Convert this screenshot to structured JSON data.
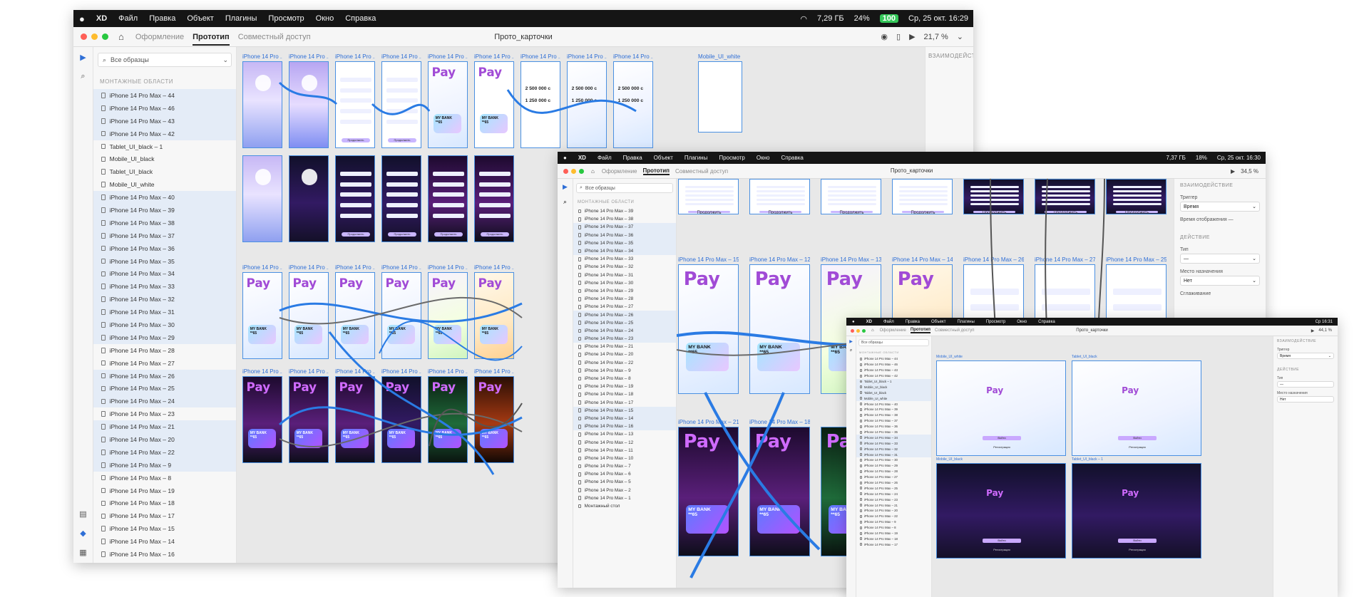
{
  "macos": {
    "app": "XD",
    "menu": [
      "Файл",
      "Правка",
      "Объект",
      "Плагины",
      "Просмотр",
      "Окно",
      "Справка"
    ],
    "status_memory": "7,29 ГБ",
    "status_battery": "24%",
    "status_badge": "100",
    "status_clock": "Ср, 25 окт.  16:29"
  },
  "toolbar": {
    "tabs": [
      "Оформление",
      "Прототип",
      "Совместный доступ"
    ],
    "active_tab": "Прототип",
    "doc_title": "Прото_карточки",
    "zoom": "21,7 %"
  },
  "sidebar": {
    "search_placeholder": "Все образцы",
    "section_title": "МОНТАЖНЫЕ ОБЛАСТИ",
    "items": [
      "iPhone 14 Pro Max – 44",
      "iPhone 14 Pro Max – 46",
      "iPhone 14 Pro Max – 43",
      "iPhone 14 Pro Max – 42",
      "Tablet_UI_black – 1",
      "Mobile_UI_black",
      "Tablet_UI_black",
      "Mobile_UI_white",
      "iPhone 14 Pro Max – 40",
      "iPhone 14 Pro Max – 39",
      "iPhone 14 Pro Max – 38",
      "iPhone 14 Pro Max – 37",
      "iPhone 14 Pro Max – 36",
      "iPhone 14 Pro Max – 35",
      "iPhone 14 Pro Max – 34",
      "iPhone 14 Pro Max – 33",
      "iPhone 14 Pro Max – 32",
      "iPhone 14 Pro Max – 31",
      "iPhone 14 Pro Max – 30",
      "iPhone 14 Pro Max – 29",
      "iPhone 14 Pro Max – 28",
      "iPhone 14 Pro Max – 27",
      "iPhone 14 Pro Max – 26",
      "iPhone 14 Pro Max – 25",
      "iPhone 14 Pro Max – 24",
      "iPhone 14 Pro Max – 23",
      "iPhone 14 Pro Max – 21",
      "iPhone 14 Pro Max – 20",
      "iPhone 14 Pro Max – 22",
      "iPhone 14 Pro Max – 9",
      "iPhone 14 Pro Max – 8",
      "iPhone 14 Pro Max – 19",
      "iPhone 14 Pro Max – 18",
      "iPhone 14 Pro Max – 17",
      "iPhone 14 Pro Max – 15",
      "iPhone 14 Pro Max – 14",
      "iPhone 14 Pro Max – 16"
    ]
  },
  "props": {
    "interaction_title": "ВЗАИМОДЕЙСТВИЕ",
    "trigger_label": "Триггер",
    "trigger_value": "Время",
    "delay_label": "Время отображения",
    "delay_value": "—",
    "action_title": "ДЕЙСТВИЕ",
    "type_label": "Тип",
    "type_value": "—",
    "dest_label": "Место назначения",
    "dest_value": "Нет",
    "ease_label": "Сглаживание"
  },
  "canvas": {
    "board_label": "iPhone 14 Pro ...",
    "board_label_white": "Mobile_UI_white",
    "pay": "Pay",
    "card_text": "MY BANK",
    "card_sub": "**65",
    "amount": "2 500 000 с",
    "amount2": "1 250 000 с",
    "amount3": "250 000 с",
    "btn_continue": "Продолжить",
    "btn_register": "Регистрация",
    "btn_login": "Войти"
  },
  "win2": {
    "status_memory": "7,37 ГБ",
    "status_battery": "18%",
    "status_clock": "Ср, 25 окт.  16:30",
    "zoom": "34,5 %",
    "board_labels": [
      "iPhone 14 Pro Max – 15",
      "iPhone 14 Pro Max – 12",
      "iPhone 14 Pro Max – 13",
      "iPhone 14 Pro Max – 14",
      "iPhone 14 Pro Max – 26",
      "iPhone 14 Pro Max – 27",
      "iPhone 14 Pro Max – 25"
    ],
    "board_labels_row2": [
      "iPhone 14 Pro Max – 21",
      "iPhone 14 Pro Max – 18"
    ],
    "sidebar_items": [
      "iPhone 14 Pro Max – 39",
      "iPhone 14 Pro Max – 38",
      "iPhone 14 Pro Max – 37",
      "iPhone 14 Pro Max – 36",
      "iPhone 14 Pro Max – 35",
      "iPhone 14 Pro Max – 34",
      "iPhone 14 Pro Max – 33",
      "iPhone 14 Pro Max – 32",
      "iPhone 14 Pro Max – 31",
      "iPhone 14 Pro Max – 30",
      "iPhone 14 Pro Max – 29",
      "iPhone 14 Pro Max – 28",
      "iPhone 14 Pro Max – 27",
      "iPhone 14 Pro Max – 26",
      "iPhone 14 Pro Max – 25",
      "iPhone 14 Pro Max – 24",
      "iPhone 14 Pro Max – 23",
      "iPhone 14 Pro Max – 21",
      "iPhone 14 Pro Max – 20",
      "iPhone 14 Pro Max – 22",
      "iPhone 14 Pro Max – 9",
      "iPhone 14 Pro Max – 8",
      "iPhone 14 Pro Max – 19",
      "iPhone 14 Pro Max – 18",
      "iPhone 14 Pro Max – 17",
      "iPhone 14 Pro Max – 15",
      "iPhone 14 Pro Max – 14",
      "iPhone 14 Pro Max – 16",
      "iPhone 14 Pro Max – 13",
      "iPhone 14 Pro Max – 12",
      "iPhone 14 Pro Max – 11",
      "iPhone 14 Pro Max – 10",
      "iPhone 14 Pro Max – 7",
      "iPhone 14 Pro Max – 6",
      "iPhone 14 Pro Max – 5",
      "iPhone 14 Pro Max – 2",
      "iPhone 14 Pro Max – 1",
      "Монтажный стол"
    ]
  },
  "win3": {
    "status_clock": "Ср 16:31",
    "zoom": "44,1 %",
    "board_labels": [
      "Mobile_UI_white",
      "Tablet_UI_black",
      "Mobile_UI_black",
      "Tablet_UI_black – 1"
    ],
    "sidebar_items": [
      "iPhone 14 Pro Max – 44",
      "iPhone 14 Pro Max – 46",
      "iPhone 14 Pro Max – 43",
      "iPhone 14 Pro Max – 42",
      "Tablet_UI_black – 1",
      "Mobile_UI_black",
      "Tablet_UI_black",
      "Mobile_UI_white",
      "iPhone 14 Pro Max – 40",
      "iPhone 14 Pro Max – 39",
      "iPhone 14 Pro Max – 38",
      "iPhone 14 Pro Max – 37",
      "iPhone 14 Pro Max – 36",
      "iPhone 14 Pro Max – 35",
      "iPhone 14 Pro Max – 34",
      "iPhone 14 Pro Max – 33",
      "iPhone 14 Pro Max – 32",
      "iPhone 14 Pro Max – 31",
      "iPhone 14 Pro Max – 30",
      "iPhone 14 Pro Max – 29",
      "iPhone 14 Pro Max – 28",
      "iPhone 14 Pro Max – 27",
      "iPhone 14 Pro Max – 26",
      "iPhone 14 Pro Max – 25",
      "iPhone 14 Pro Max – 24",
      "iPhone 14 Pro Max – 23",
      "iPhone 14 Pro Max – 21",
      "iPhone 14 Pro Max – 20",
      "iPhone 14 Pro Max – 22",
      "iPhone 14 Pro Max – 9",
      "iPhone 14 Pro Max – 8",
      "iPhone 14 Pro Max – 19",
      "iPhone 14 Pro Max – 18",
      "iPhone 14 Pro Max – 17"
    ]
  }
}
